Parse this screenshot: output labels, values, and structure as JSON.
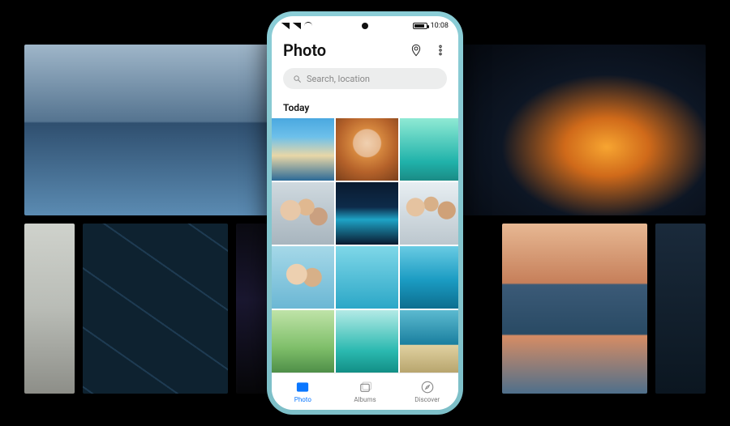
{
  "status": {
    "time": "10:08"
  },
  "header": {
    "title": "Photo"
  },
  "search": {
    "placeholder": "Search, location"
  },
  "section": {
    "today_label": "Today"
  },
  "nav": {
    "photo": {
      "label": "Photo"
    },
    "albums": {
      "label": "Albums"
    },
    "discover": {
      "label": "Discover"
    }
  }
}
